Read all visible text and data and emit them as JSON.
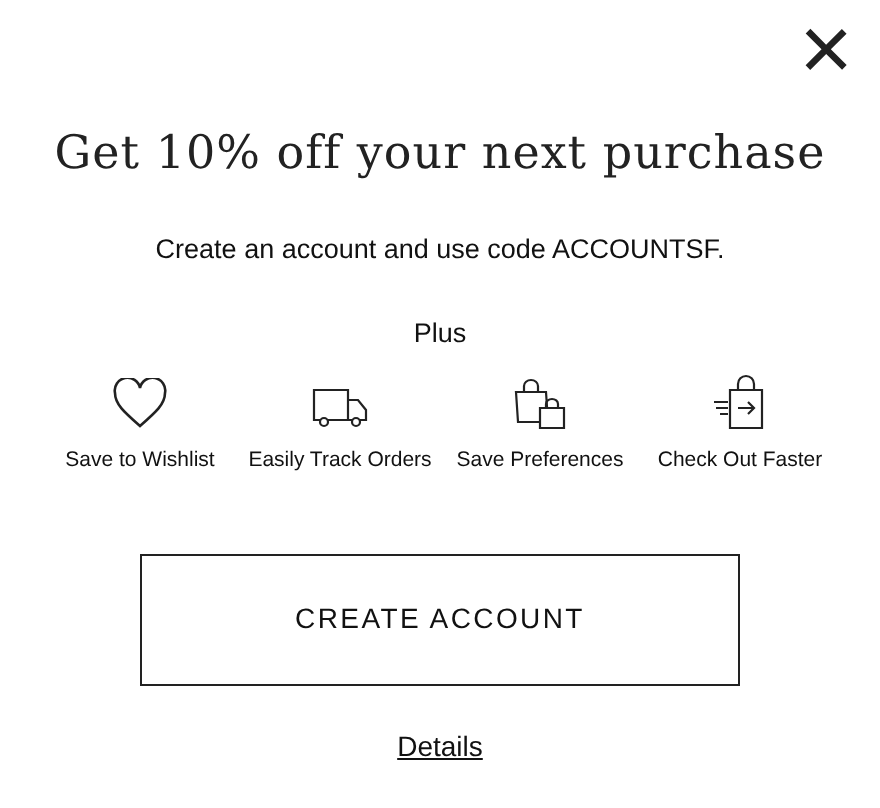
{
  "close_button": {
    "label": "×"
  },
  "title": "Get 10% off your next purchase",
  "subtitle": "Create an account and use code ACCOUNTSF.",
  "benefits_heading": "Plus",
  "benefits": [
    {
      "kind": "heart",
      "label": "Save to Wishlist"
    },
    {
      "kind": "truck",
      "label": "Easily Track Orders"
    },
    {
      "kind": "bags",
      "label": "Save Preferences"
    },
    {
      "kind": "checkout",
      "label": "Check Out Faster"
    }
  ],
  "primary_button": "CREATE ACCOUNT",
  "details_link": "Details"
}
